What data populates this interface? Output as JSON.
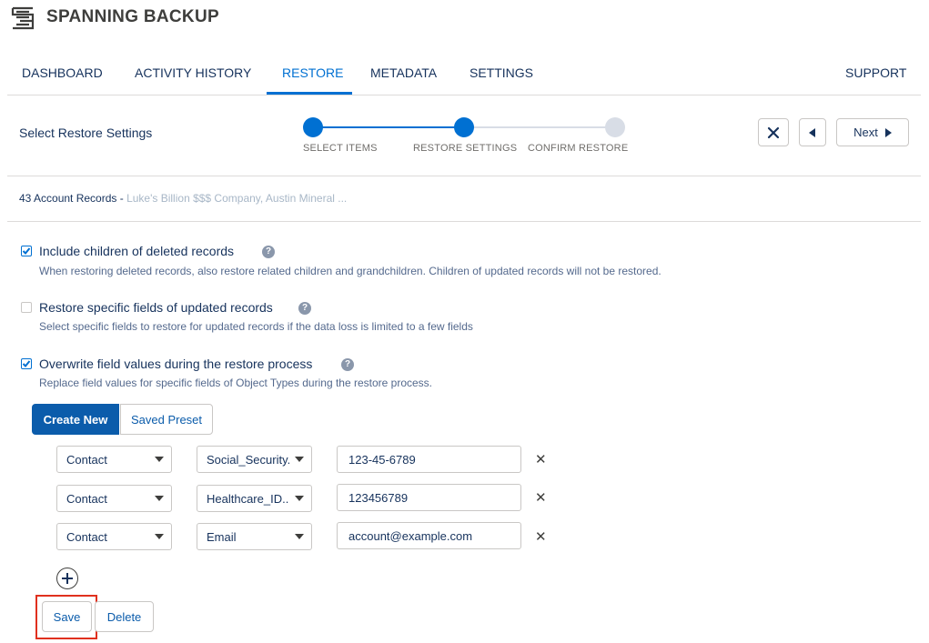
{
  "app": {
    "brand": "SPANNING BACKUP"
  },
  "nav": {
    "items": [
      {
        "label": "DASHBOARD"
      },
      {
        "label": "ACTIVITY HISTORY"
      },
      {
        "label": "RESTORE"
      },
      {
        "label": "METADATA"
      },
      {
        "label": "SETTINGS"
      }
    ],
    "active": "RESTORE",
    "support": "SUPPORT"
  },
  "stepper": {
    "title": "Select Restore Settings",
    "steps": [
      {
        "label": "SELECT ITEMS",
        "state": "done"
      },
      {
        "label": "RESTORE SETTINGS",
        "state": "current"
      },
      {
        "label": "CONFIRM RESTORE",
        "state": "pending"
      }
    ],
    "next_label": "Next"
  },
  "records": {
    "count_label": "43 Account Records -",
    "names": "Luke's Billion $$$ Company, Austin Mineral ..."
  },
  "options": [
    {
      "title": "Include children of deleted records",
      "description": "When restoring deleted records, also restore related children and grandchildren. Children of updated records will not be restored.",
      "checked": true
    },
    {
      "title": "Restore specific fields of updated records",
      "description": "Select specific fields to restore for updated records if the data loss is limited to a few fields",
      "checked": false
    },
    {
      "title": "Overwrite field values during the restore process",
      "description": "Replace field values for specific fields of Object Types during the restore process.",
      "checked": true
    }
  ],
  "help_glyph": "?",
  "presets": {
    "create_new": "Create New",
    "saved_preset": "Saved Preset"
  },
  "field_rows": [
    {
      "object": "Contact",
      "field": "Social_Security...",
      "value": "123-45-6789"
    },
    {
      "object": "Contact",
      "field": "Healthcare_ID...",
      "value": "123456789"
    },
    {
      "object": "Contact",
      "field": "Email",
      "value": "account@example.com"
    }
  ],
  "remove_glyph": "✕",
  "actions": {
    "save": "Save",
    "delete": "Delete"
  },
  "colors": {
    "accent": "#0070d2",
    "brand_button": "#0b5cab",
    "highlight": "#e0301e",
    "step_inactive": "#d8dde6"
  }
}
